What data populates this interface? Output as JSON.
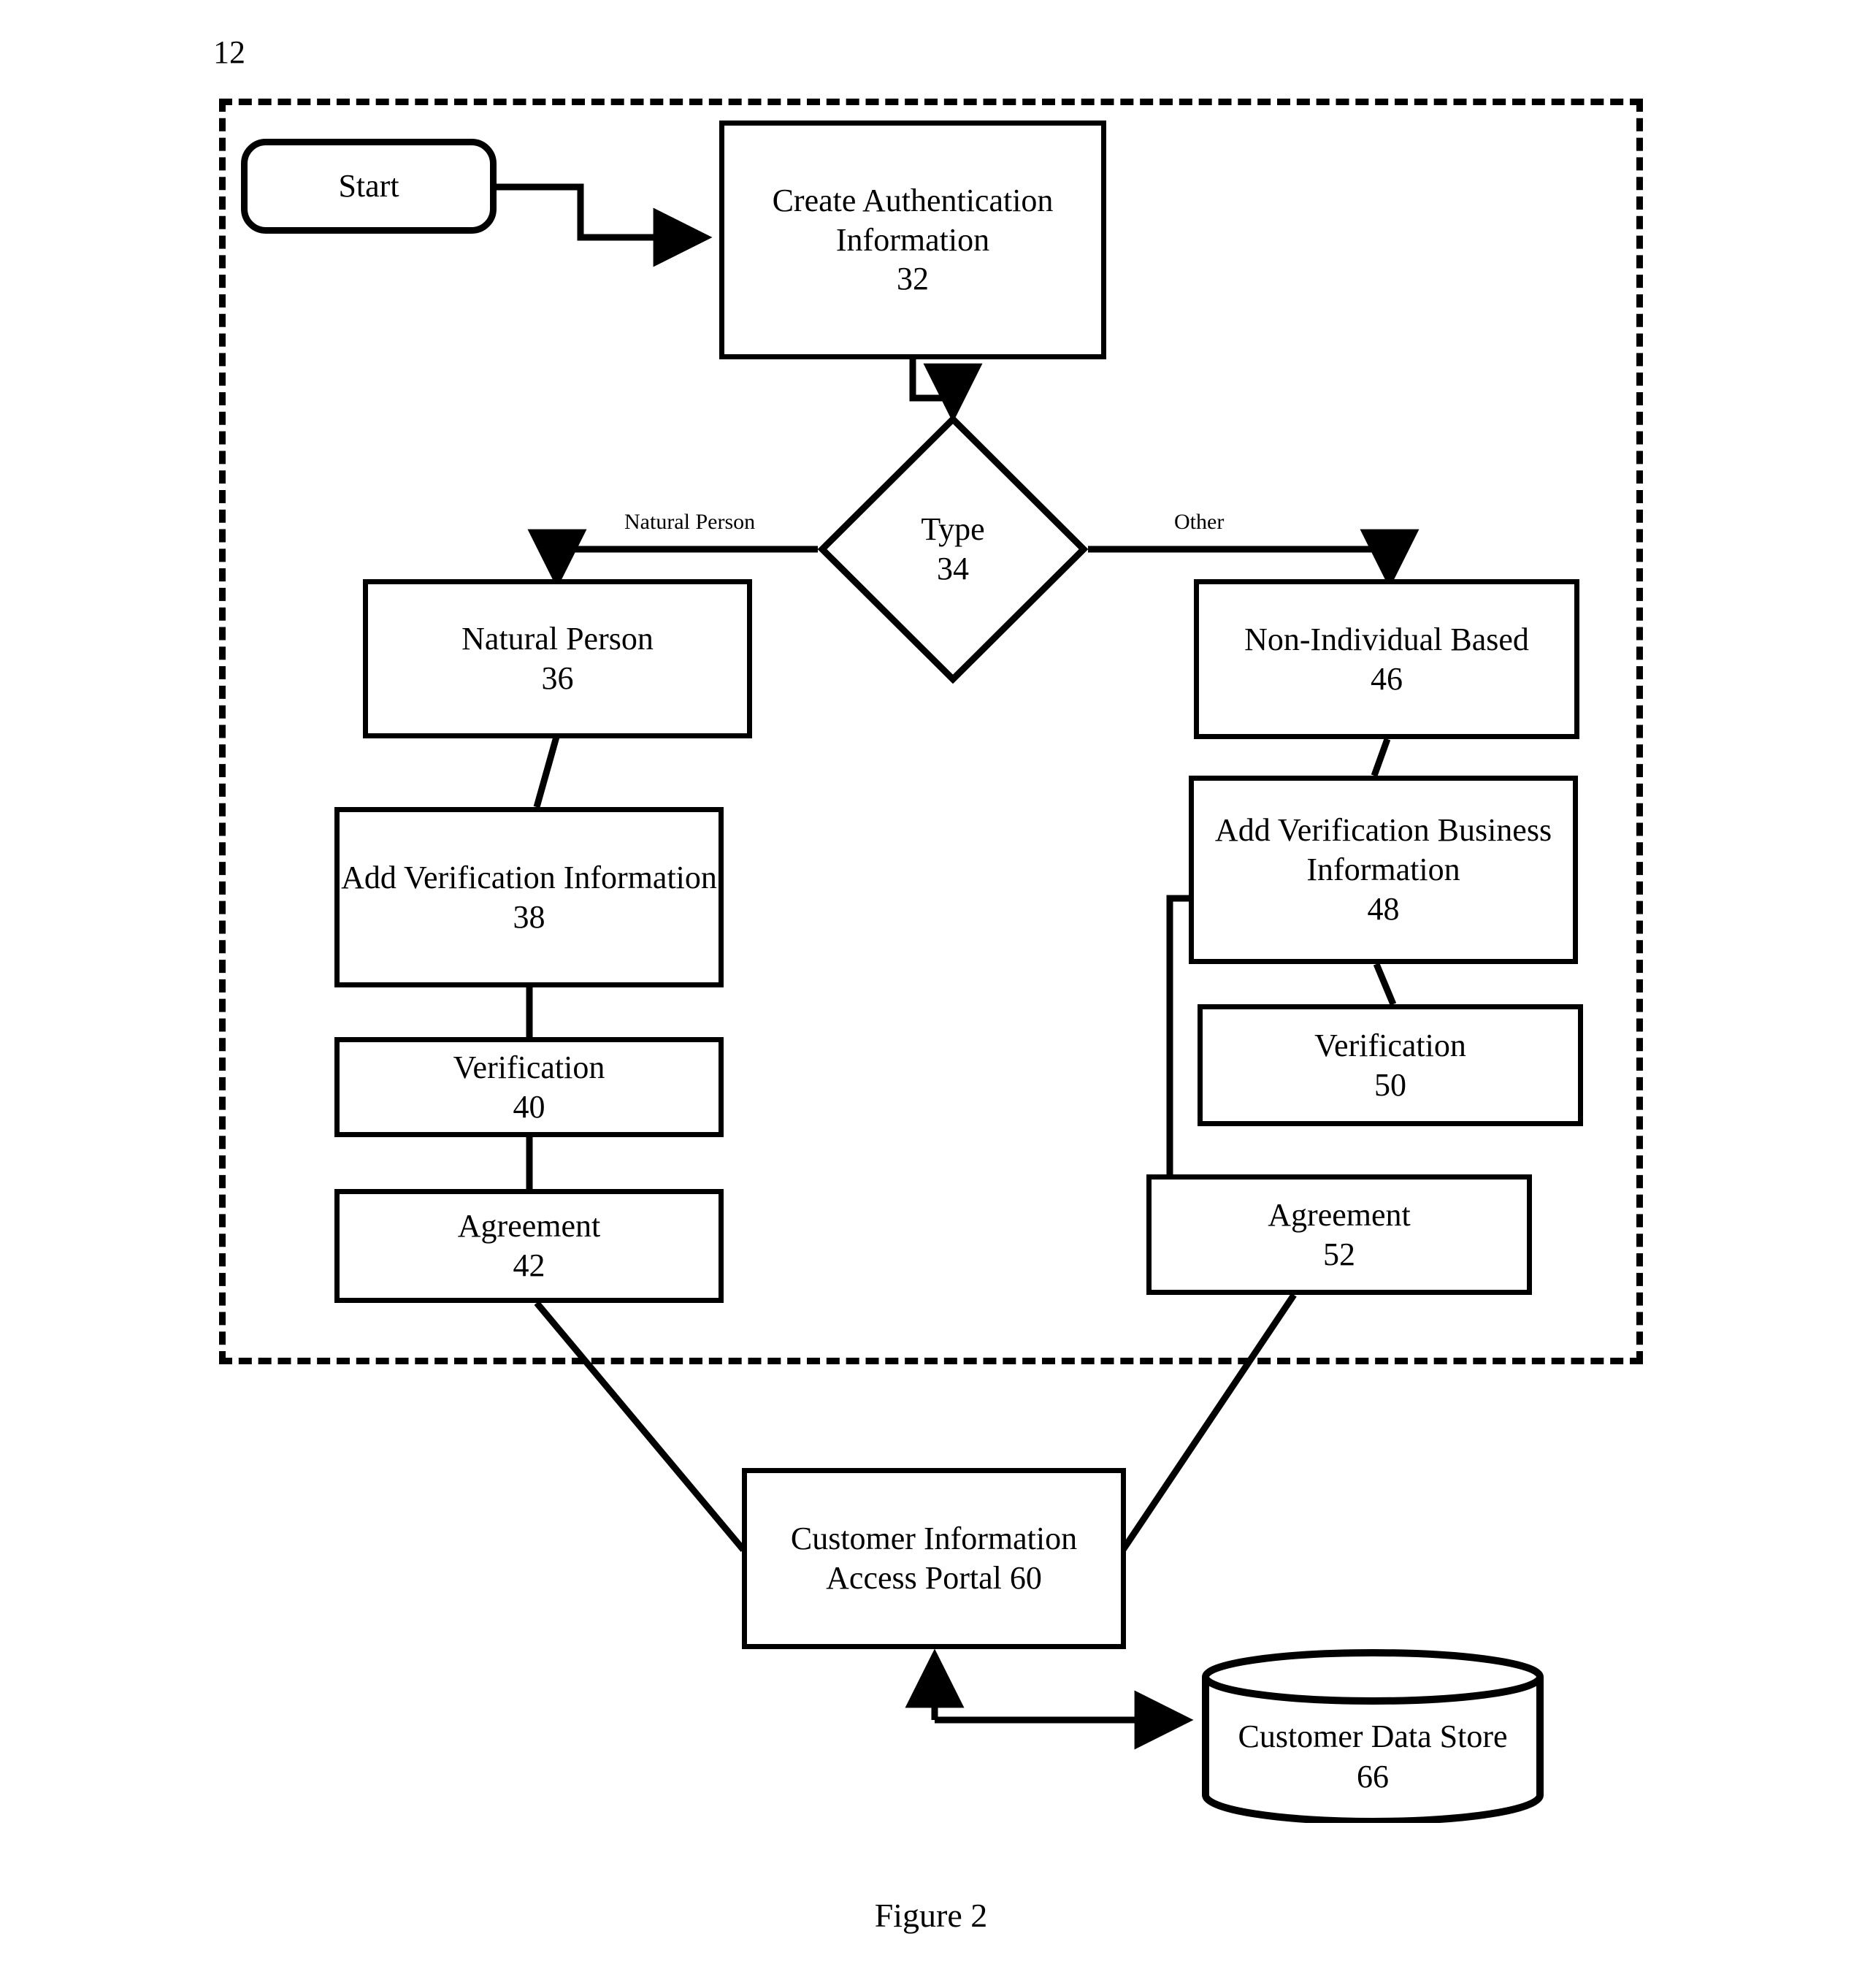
{
  "figure": {
    "caption": "Figure 2",
    "region_label": "12"
  },
  "nodes": {
    "start": {
      "label": "Start",
      "number": ""
    },
    "create_auth": {
      "label": "Create Authentication Information",
      "number": "32"
    },
    "type_decision": {
      "label": "Type",
      "number": "34"
    },
    "natural_person": {
      "label": "Natural Person",
      "number": "36"
    },
    "add_verification_info": {
      "label": "Add Verification Information",
      "number": "38"
    },
    "verification_left": {
      "label": "Verification",
      "number": "40"
    },
    "agreement_left": {
      "label": "Agreement",
      "number": "42"
    },
    "non_individual": {
      "label": "Non-Individual Based",
      "number": "46"
    },
    "add_verification_business": {
      "label": "Add Verification Business Information",
      "number": "48"
    },
    "verification_right": {
      "label": "Verification",
      "number": "50"
    },
    "agreement_right": {
      "label": "Agreement",
      "number": "52"
    },
    "portal": {
      "label": "Customer Information Access Portal 60",
      "number": "60"
    },
    "data_store": {
      "label": "Customer Data Store",
      "number": "66"
    }
  },
  "edge_labels": {
    "natural_person_branch": "Natural Person",
    "other_branch": "Other"
  },
  "colors": {
    "stroke": "#000000",
    "background": "#ffffff"
  },
  "chart_data": {
    "type": "flowchart",
    "title": "Figure 2",
    "boundary_label": "12",
    "nodes": [
      {
        "id": "start",
        "shape": "rounded-rectangle",
        "text": "Start",
        "ref": null
      },
      {
        "id": "32",
        "shape": "rectangle",
        "text": "Create Authentication Information",
        "ref": 32
      },
      {
        "id": "34",
        "shape": "diamond",
        "text": "Type",
        "ref": 34
      },
      {
        "id": "36",
        "shape": "rectangle",
        "text": "Natural Person",
        "ref": 36
      },
      {
        "id": "38",
        "shape": "rectangle",
        "text": "Add Verification Information",
        "ref": 38
      },
      {
        "id": "40",
        "shape": "rectangle",
        "text": "Verification",
        "ref": 40
      },
      {
        "id": "42",
        "shape": "rectangle",
        "text": "Agreement",
        "ref": 42
      },
      {
        "id": "46",
        "shape": "rectangle",
        "text": "Non-Individual Based",
        "ref": 46
      },
      {
        "id": "48",
        "shape": "rectangle",
        "text": "Add Verification Business Information",
        "ref": 48
      },
      {
        "id": "50",
        "shape": "rectangle",
        "text": "Verification",
        "ref": 50
      },
      {
        "id": "52",
        "shape": "rectangle",
        "text": "Agreement",
        "ref": 52
      },
      {
        "id": "60",
        "shape": "rectangle",
        "text": "Customer Information Access Portal 60",
        "ref": 60
      },
      {
        "id": "66",
        "shape": "cylinder",
        "text": "Customer Data Store",
        "ref": 66
      }
    ],
    "edges": [
      {
        "from": "start",
        "to": "32",
        "label": "",
        "arrow": true
      },
      {
        "from": "32",
        "to": "34",
        "label": "",
        "arrow": true
      },
      {
        "from": "34",
        "to": "36",
        "label": "Natural Person",
        "arrow": true
      },
      {
        "from": "34",
        "to": "46",
        "label": "Other",
        "arrow": true
      },
      {
        "from": "36",
        "to": "38",
        "label": "",
        "arrow": false
      },
      {
        "from": "38",
        "to": "40",
        "label": "",
        "arrow": false
      },
      {
        "from": "40",
        "to": "42",
        "label": "",
        "arrow": false
      },
      {
        "from": "46",
        "to": "48",
        "label": "",
        "arrow": false
      },
      {
        "from": "48",
        "to": "50",
        "label": "",
        "arrow": false
      },
      {
        "from": "48",
        "to": "52",
        "label": "",
        "arrow": false
      },
      {
        "from": "42",
        "to": "60",
        "label": "",
        "arrow": false
      },
      {
        "from": "52",
        "to": "60",
        "label": "",
        "arrow": false
      },
      {
        "from": "66",
        "to": "60",
        "label": "",
        "arrow": true
      },
      {
        "from": "60",
        "to": "66",
        "label": "",
        "arrow": true
      }
    ]
  }
}
